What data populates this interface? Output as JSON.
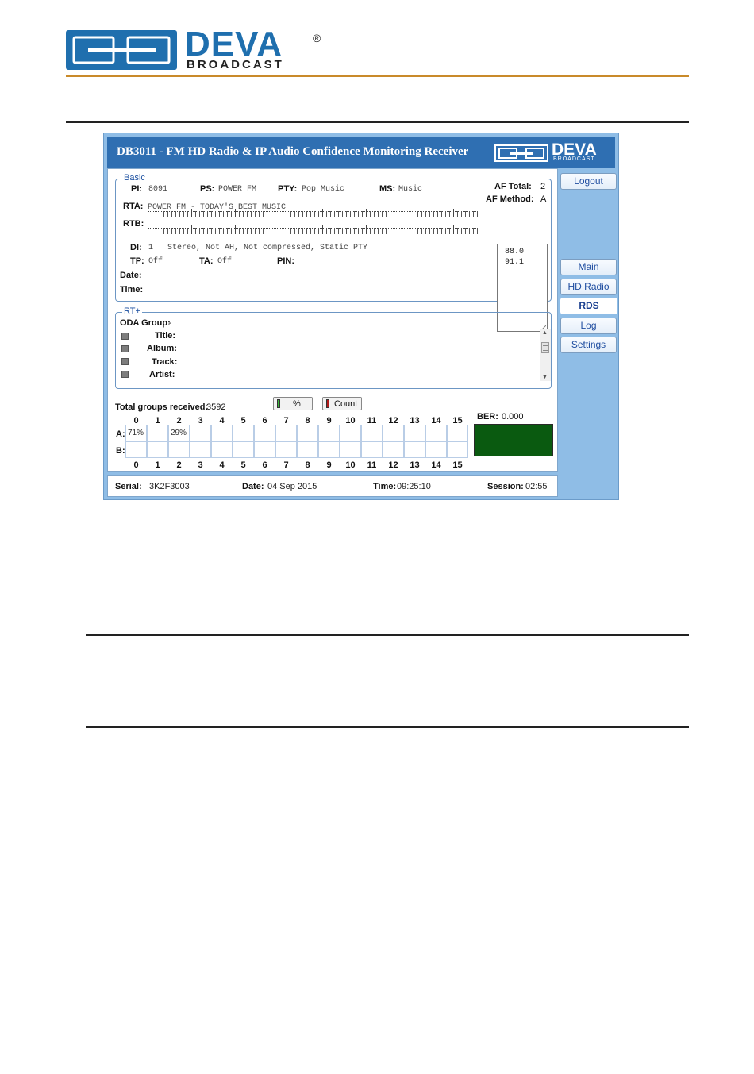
{
  "doc": {
    "logo_text": "DEVA",
    "logo_registered": "®",
    "logo_subtext": "BROADCAST"
  },
  "app": {
    "title": "DB3011 - FM HD Radio & IP Audio Confidence Monitoring Receiver",
    "logo_text": "DEVA",
    "logo_subtext": "BROADCAST"
  },
  "basic": {
    "legend": "Basic",
    "pi_label": "PI:",
    "pi_value": "8091",
    "ps_label": "PS:",
    "ps_value": "POWER FM",
    "pty_label": "PTY:",
    "pty_value": "Pop Music",
    "ms_label": "MS:",
    "ms_value": "Music",
    "af_total_label": "AF Total:",
    "af_total_value": "2",
    "af_method_label": "AF Method:",
    "af_method_value": "A",
    "af_list": [
      "88.0",
      "91.1"
    ],
    "rta_label": "RTA:",
    "rta_value": "POWER FM - TODAY'S BEST MUSIC",
    "rtb_label": "RTB:",
    "rtb_value": "",
    "di_label": "DI:",
    "di_value": "1   Stereo, Not AH, Not compressed, Static PTY",
    "tp_label": "TP:",
    "tp_value": "Off",
    "ta_label": "TA:",
    "ta_value": "Off",
    "pin_label": "PIN:",
    "pin_value": "",
    "date_label": "Date:",
    "date_value": "",
    "time_label": "Time:",
    "time_value": ""
  },
  "rtplus": {
    "legend": "RT+",
    "oda_label": "ODA Group:",
    "oda_value": "-",
    "title_label": "Title:",
    "album_label": "Album:",
    "track_label": "Track:",
    "artist_label": "Artist:"
  },
  "groups": {
    "total_label": "Total groups received:",
    "total_value": "3592",
    "percent_button": "%",
    "count_button": "Count",
    "ber_label": "BER:",
    "ber_value": "0.000",
    "row_a_label": "A:",
    "row_b_label": "B:",
    "numbers": [
      "0",
      "1",
      "2",
      "3",
      "4",
      "5",
      "6",
      "7",
      "8",
      "9",
      "10",
      "11",
      "12",
      "13",
      "14",
      "15"
    ],
    "row_a": [
      "71%",
      "",
      "29%",
      "",
      "",
      "",
      "",
      "",
      "",
      "",
      "",
      "",
      "",
      "",
      "",
      ""
    ],
    "row_b": [
      "",
      "",
      "",
      "",
      "",
      "",
      "",
      "",
      "",
      "",
      "",
      "",
      "",
      "",
      "",
      ""
    ]
  },
  "sidebar": {
    "logout": "Logout",
    "main": "Main",
    "hd_radio": "HD Radio",
    "rds": "RDS",
    "log": "Log",
    "settings": "Settings"
  },
  "status": {
    "serial_label": "Serial:",
    "serial_value": "3K2F3003",
    "date_label": "Date:",
    "date_value": "04 Sep 2015",
    "time_label": "Time:",
    "time_value": "09:25:10",
    "session_label": "Session:",
    "session_value": "02:55"
  },
  "colors": {
    "brand_blue": "#1f6fae",
    "header_blue": "#2f6fb2",
    "panel_blue": "#8fbde6",
    "ber_green": "#0a5a10",
    "percent_led": "#3bb83b",
    "count_led": "#b11a1a"
  }
}
